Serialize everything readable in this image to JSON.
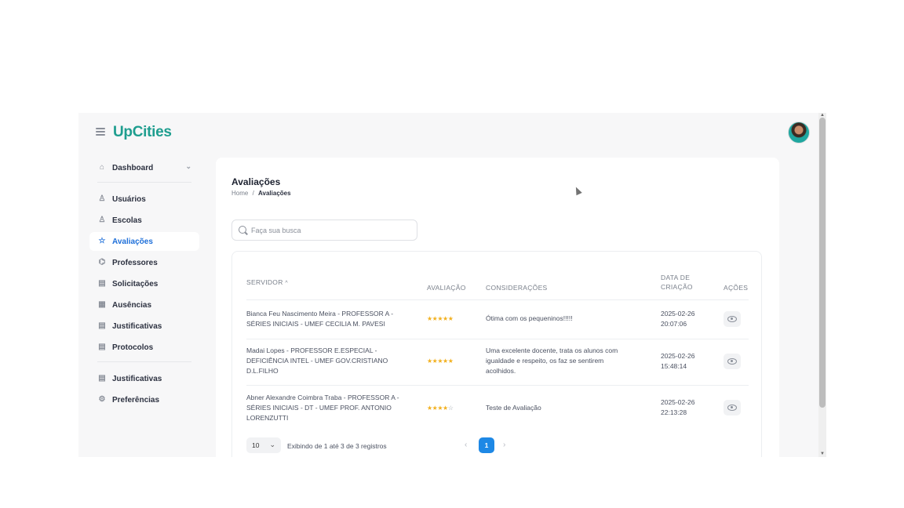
{
  "app": {
    "logo": "UpCities"
  },
  "sidebar": {
    "items": [
      {
        "label": "Dashboard",
        "icon": "home-icon",
        "has_chevron": true
      },
      {
        "label": "Usuários",
        "icon": "user-icon"
      },
      {
        "label": "Escolas",
        "icon": "user-icon"
      },
      {
        "label": "Avaliações",
        "icon": "star-icon",
        "active": true
      },
      {
        "label": "Professores",
        "icon": "graduation-cap-icon"
      },
      {
        "label": "Solicitações",
        "icon": "document-icon"
      },
      {
        "label": "Ausências",
        "icon": "calendar-icon"
      },
      {
        "label": "Justificativas",
        "icon": "document-icon"
      },
      {
        "label": "Protocolos",
        "icon": "document-icon"
      },
      {
        "label": "Justificativas",
        "icon": "document-icon"
      },
      {
        "label": "Preferências",
        "icon": "gear-icon"
      }
    ]
  },
  "page": {
    "title": "Avaliações",
    "breadcrumb": {
      "home": "Home",
      "separator": "/",
      "current": "Avaliações"
    }
  },
  "search": {
    "placeholder": "Faça sua busca",
    "value": ""
  },
  "table": {
    "headers": {
      "servidor": "SERVIDOR",
      "sort_glyph": "^",
      "avaliacao": "AVALIAÇÃO",
      "consideracoes": "CONSIDERAÇÕES",
      "data_criacao_1": "DATA DE",
      "data_criacao_2": "CRIAÇÃO",
      "acoes": "AÇÕES"
    },
    "rows": [
      {
        "servidor_1": "Bianca Feu Nascimento Meira - PROFESSOR A -",
        "servidor_2": "SÉRIES INICIAIS - UMEF CECILIA M. PAVESI",
        "servidor_3": "",
        "rating": 5,
        "stars_on": "★★★★★",
        "stars_off": "",
        "consideracoes_1": "Ótima com os pequeninos!!!!!",
        "consideracoes_2": "",
        "consideracoes_3": "",
        "date": "2025-02-26",
        "time": "20:07:06"
      },
      {
        "servidor_1": "Madai Lopes - PROFESSOR E.ESPECIAL -",
        "servidor_2": "DEFICIÊNCIA INTEL - UMEF GOV.CRISTIANO",
        "servidor_3": "D.L.FILHO",
        "rating": 5,
        "stars_on": "★★★★★",
        "stars_off": "",
        "consideracoes_1": "Uma excelente docente, trata os alunos com",
        "consideracoes_2": "igualdade e respeito, os faz se sentirem",
        "consideracoes_3": "acolhidos.",
        "date": "2025-02-26",
        "time": "15:48:14"
      },
      {
        "servidor_1": "Abner Alexandre Coimbra Traba - PROFESSOR A -",
        "servidor_2": "SÉRIES INICIAIS - DT - UMEF PROF. ANTONIO",
        "servidor_3": "LORENZUTTI",
        "rating": 4,
        "stars_on": "★★★★",
        "stars_off": "☆",
        "consideracoes_1": "Teste de Avaliação",
        "consideracoes_2": "",
        "consideracoes_3": "",
        "date": "2025-02-26",
        "time": "22:13:28"
      }
    ]
  },
  "pagination": {
    "page_size": "10",
    "info": "Exibindo de 1 até 3 de 3 registros",
    "prev": "‹",
    "next": "›",
    "current_page": "1"
  },
  "colors": {
    "brand": "#1f9e8f",
    "active": "#1e6fd9",
    "page_button": "#1e88e5",
    "star": "#f2b01e"
  }
}
